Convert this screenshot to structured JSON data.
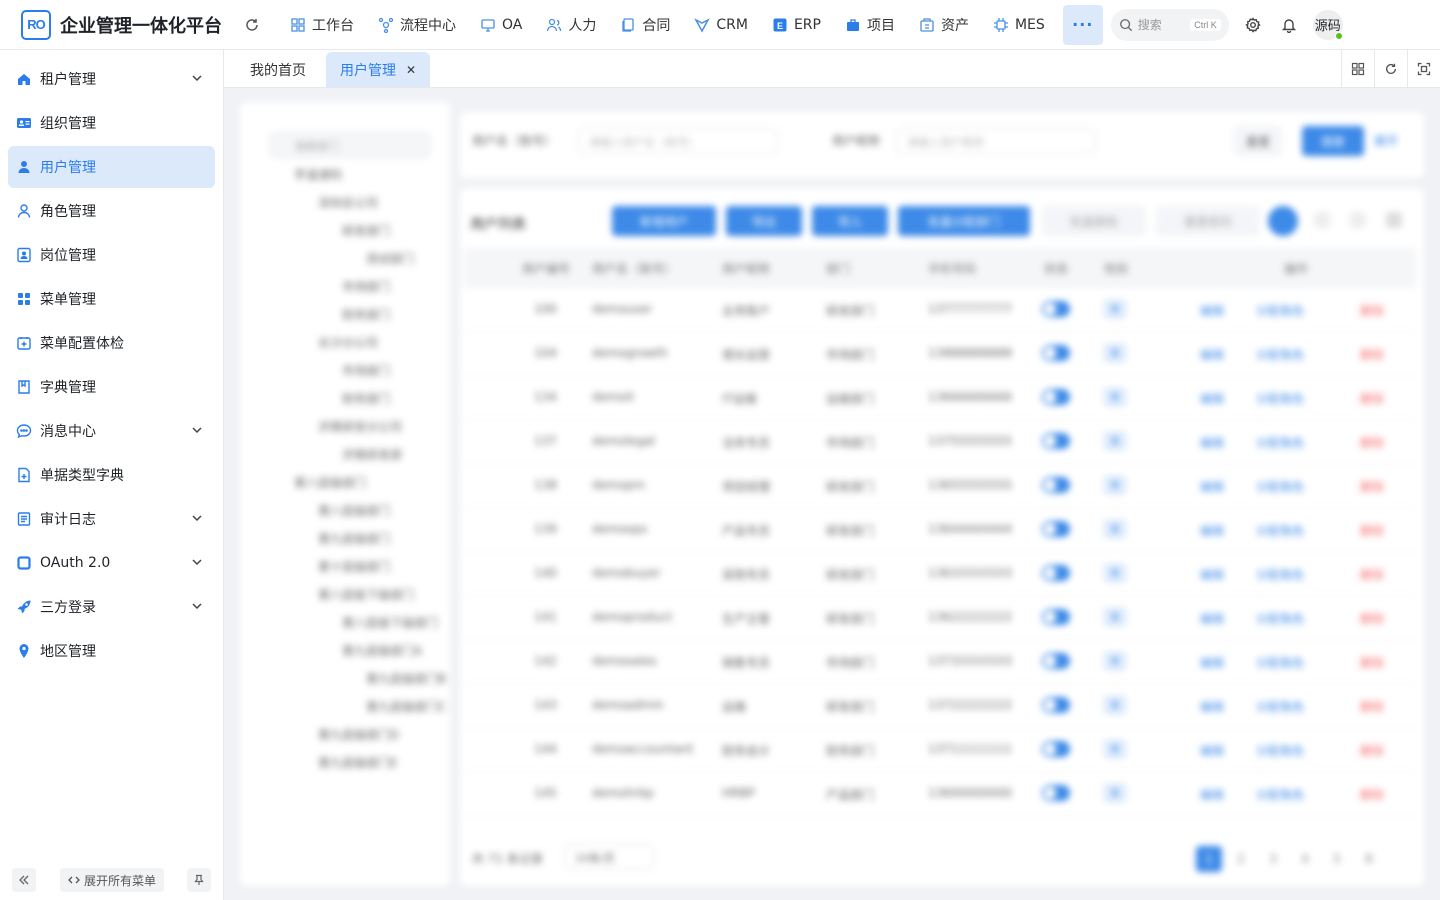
{
  "app": {
    "logo_text": "RO",
    "brand": "企业管理一体化平台"
  },
  "topnav": [
    {
      "label": "工作台",
      "icon": "dashboard-icon"
    },
    {
      "label": "流程中心",
      "icon": "workflow-icon"
    },
    {
      "label": "OA",
      "icon": "monitor-icon"
    },
    {
      "label": "人力",
      "icon": "people-icon"
    },
    {
      "label": "合同",
      "icon": "contract-icon"
    },
    {
      "label": "CRM",
      "icon": "crm-icon"
    },
    {
      "label": "ERP",
      "icon": "erp-icon"
    },
    {
      "label": "项目",
      "icon": "briefcase-icon"
    },
    {
      "label": "资产",
      "icon": "asset-icon"
    },
    {
      "label": "MES",
      "icon": "chip-icon"
    }
  ],
  "header": {
    "more_label": "···",
    "search_placeholder": "搜索",
    "search_shortcut": "Ctrl K",
    "avatar_text": "源码"
  },
  "sidebar": {
    "items": [
      {
        "label": "租户管理",
        "icon": "house-icon",
        "expandable": true
      },
      {
        "label": "组织管理",
        "icon": "id-card-icon",
        "expandable": false
      },
      {
        "label": "用户管理",
        "icon": "user-icon",
        "expandable": false,
        "active": true
      },
      {
        "label": "角色管理",
        "icon": "user-outline-icon",
        "expandable": false
      },
      {
        "label": "岗位管理",
        "icon": "badge-icon",
        "expandable": false
      },
      {
        "label": "菜单管理",
        "icon": "grid-icon",
        "expandable": false
      },
      {
        "label": "菜单配置体检",
        "icon": "check-box-icon",
        "expandable": false
      },
      {
        "label": "字典管理",
        "icon": "book-icon",
        "expandable": false
      },
      {
        "label": "消息中心",
        "icon": "chat-icon",
        "expandable": true
      },
      {
        "label": "单据类型字典",
        "icon": "document-icon",
        "expandable": false
      },
      {
        "label": "审计日志",
        "icon": "log-icon",
        "expandable": true
      },
      {
        "label": "OAuth 2.0",
        "icon": "square-icon",
        "expandable": true
      },
      {
        "label": "三方登录",
        "icon": "rocket-icon",
        "expandable": true
      },
      {
        "label": "地区管理",
        "icon": "location-pin-icon",
        "expandable": false
      }
    ],
    "expand_all_label": "展开所有菜单"
  },
  "tabs": [
    {
      "label": "我的首页",
      "active": false
    },
    {
      "label": "用户管理",
      "active": true
    }
  ],
  "colors": {
    "accent": "#2b7de9",
    "accent_light": "#dbe9fb",
    "danger": "#f56c6c",
    "online": "#52c41a"
  },
  "blurred_content": {
    "tree_search": "搜索部门",
    "tree": [
      "芋道源码",
      "深圳总公司",
      "研发部门",
      "测试部门",
      "市场部门",
      "财务部门",
      "长沙分公司",
      "市场部门",
      "财务部门",
      "济南研发分公司",
      "济南研发部",
      "第八层级部门",
      "第八层级部门",
      "第九层级部门",
      "第十层级部门",
      "第八层级下级部门",
      "第八层级下级部门",
      "第九层级部门A",
      "第九层级部门B",
      "第九层级部门C",
      "第九层级部门D",
      "第九层级部门E"
    ],
    "filter_username_label": "用户名（账号）",
    "filter_username_placeholder": "请输入用户名（账号）",
    "filter_nickname_label": "用户昵称",
    "filter_nickname_placeholder": "请输入用户昵称",
    "reset_label": "重置",
    "search_label": "搜索",
    "expand_label": "展开",
    "table_title": "用户列表",
    "toolbar": [
      "新增用户",
      "导出",
      "导入",
      "批量分配部门",
      "批量删除",
      "重置密码"
    ],
    "columns": [
      "用户编号",
      "用户名（账号）",
      "用户昵称",
      "部门",
      "手机号码",
      "状态",
      "性别",
      "操作"
    ],
    "rows": [
      {
        "id": "100",
        "username": "demouser",
        "nickname": "业务账户",
        "dept": "研发部门",
        "phone": "13777777777"
      },
      {
        "id": "104",
        "username": "demogrowth",
        "nickname": "增长运营",
        "dept": "市场部门",
        "phone": "13888888888"
      },
      {
        "id": "134",
        "username": "demoit",
        "nickname": "IT运维",
        "dept": "运维部门",
        "phone": "13666666666"
      },
      {
        "id": "137",
        "username": "demolegal",
        "nickname": "法务专员",
        "dept": "市场部门",
        "phone": "13755555555"
      },
      {
        "id": "138",
        "username": "demopm",
        "nickname": "项目经理",
        "dept": "研发部门",
        "phone": "13655555555"
      },
      {
        "id": "139",
        "username": "demoops",
        "nickname": "产品专员",
        "dept": "研发部门",
        "phone": "13644444444"
      },
      {
        "id": "140",
        "username": "demobuyer",
        "nickname": "采购专员",
        "dept": "研发部门",
        "phone": "13633333333"
      },
      {
        "id": "141",
        "username": "demoproduct",
        "nickname": "生产主管",
        "dept": "研发部门",
        "phone": "13622222222"
      },
      {
        "id": "142",
        "username": "demosales",
        "nickname": "销售专员",
        "dept": "市场部门",
        "phone": "13733333333"
      },
      {
        "id": "143",
        "username": "demoadmin",
        "nickname": "运维",
        "dept": "研发部门",
        "phone": "13722222222"
      },
      {
        "id": "144",
        "username": "demoaccountant",
        "nickname": "财务会计",
        "dept": "财务部门",
        "phone": "13711111111"
      },
      {
        "id": "145",
        "username": "demohrbp",
        "nickname": "HRBP",
        "dept": "产品部门",
        "phone": "13600000000"
      }
    ],
    "row_actions": [
      "编辑",
      "分配角色",
      "删除"
    ],
    "gender_tag": "男",
    "pagination_total": "共 71 条记录",
    "page_size": "10条/页",
    "pages": [
      "1",
      "2",
      "3",
      "4",
      "5",
      "8"
    ]
  }
}
